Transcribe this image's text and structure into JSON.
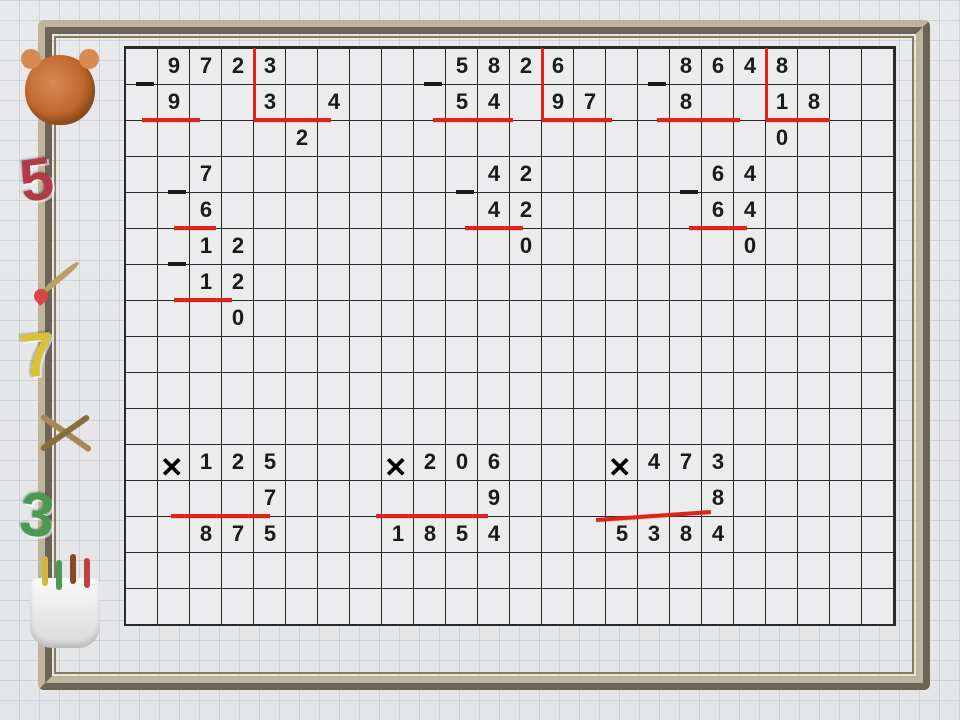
{
  "sidebar": {
    "deco_numbers": {
      "five": "5",
      "seven": "7",
      "three": "3"
    }
  },
  "problems": {
    "top_division": [
      {
        "dividend": "972",
        "divisor": "3",
        "quotient_cells": [
          "3",
          "",
          "4"
        ],
        "steps": [
          "9",
          "",
          "",
          "7",
          "6",
          "1",
          "2",
          "1",
          "2",
          "",
          "0"
        ]
      },
      {
        "dividend": "582",
        "divisor": "6",
        "quotient_cells": [
          "9",
          "7"
        ],
        "steps": [
          "5",
          "4",
          "4",
          "2",
          "4",
          "2",
          "",
          "0"
        ]
      },
      {
        "dividend": "864",
        "divisor": "8",
        "quotient_cells": [
          "1",
          "0",
          "8"
        ],
        "steps": [
          "8",
          "",
          "",
          "6",
          "4",
          "6",
          "4",
          "",
          "0"
        ]
      }
    ],
    "bottom_multiplication": [
      {
        "top": "125",
        "bottom": "7",
        "result": "875"
      },
      {
        "top": "206",
        "bottom": "9",
        "result": "1854"
      },
      {
        "top": "473",
        "bottom": "8",
        "result": "5384"
      }
    ]
  },
  "cells": [
    {
      "r": 0,
      "c": 1,
      "v": "9"
    },
    {
      "r": 0,
      "c": 2,
      "v": "7"
    },
    {
      "r": 0,
      "c": 3,
      "v": "2"
    },
    {
      "r": 0,
      "c": 4,
      "v": "3"
    },
    {
      "r": 1,
      "c": 1,
      "v": "9"
    },
    {
      "r": 1,
      "c": 4,
      "v": "3"
    },
    {
      "r": 1,
      "c": 6,
      "v": "4"
    },
    {
      "r": 2,
      "c": 5,
      "v": "2"
    },
    {
      "r": 3,
      "c": 2,
      "v": "7"
    },
    {
      "r": 4,
      "c": 2,
      "v": "6"
    },
    {
      "r": 5,
      "c": 2,
      "v": "1"
    },
    {
      "r": 5,
      "c": 3,
      "v": "2"
    },
    {
      "r": 6,
      "c": 2,
      "v": "1"
    },
    {
      "r": 6,
      "c": 3,
      "v": "2"
    },
    {
      "r": 7,
      "c": 3,
      "v": "0"
    },
    {
      "r": 0,
      "c": 10,
      "v": "5"
    },
    {
      "r": 0,
      "c": 11,
      "v": "8"
    },
    {
      "r": 0,
      "c": 12,
      "v": "2"
    },
    {
      "r": 0,
      "c": 13,
      "v": "6"
    },
    {
      "r": 1,
      "c": 10,
      "v": "5"
    },
    {
      "r": 1,
      "c": 11,
      "v": "4"
    },
    {
      "r": 1,
      "c": 13,
      "v": "9"
    },
    {
      "r": 1,
      "c": 14,
      "v": "7"
    },
    {
      "r": 3,
      "c": 11,
      "v": "4"
    },
    {
      "r": 3,
      "c": 12,
      "v": "2"
    },
    {
      "r": 4,
      "c": 11,
      "v": "4"
    },
    {
      "r": 4,
      "c": 12,
      "v": "2"
    },
    {
      "r": 5,
      "c": 12,
      "v": "0"
    },
    {
      "r": 0,
      "c": 17,
      "v": "8"
    },
    {
      "r": 0,
      "c": 18,
      "v": "6"
    },
    {
      "r": 0,
      "c": 19,
      "v": "4"
    },
    {
      "r": 0,
      "c": 20,
      "v": "8"
    },
    {
      "r": 1,
      "c": 17,
      "v": "8"
    },
    {
      "r": 1,
      "c": 20,
      "v": "1"
    },
    {
      "r": 1,
      "c": 21,
      "v": "8"
    },
    {
      "r": 2,
      "c": 20,
      "v": "0"
    },
    {
      "r": 3,
      "c": 18,
      "v": "6"
    },
    {
      "r": 3,
      "c": 19,
      "v": "4"
    },
    {
      "r": 4,
      "c": 18,
      "v": "6"
    },
    {
      "r": 4,
      "c": 19,
      "v": "4"
    },
    {
      "r": 5,
      "c": 19,
      "v": "0"
    },
    {
      "r": 11,
      "c": 2,
      "v": "1"
    },
    {
      "r": 11,
      "c": 3,
      "v": "2"
    },
    {
      "r": 11,
      "c": 4,
      "v": "5"
    },
    {
      "r": 12,
      "c": 4,
      "v": "7"
    },
    {
      "r": 13,
      "c": 2,
      "v": "8"
    },
    {
      "r": 13,
      "c": 3,
      "v": "7"
    },
    {
      "r": 13,
      "c": 4,
      "v": "5"
    },
    {
      "r": 11,
      "c": 9,
      "v": "2"
    },
    {
      "r": 11,
      "c": 10,
      "v": "0"
    },
    {
      "r": 11,
      "c": 11,
      "v": "6"
    },
    {
      "r": 12,
      "c": 11,
      "v": "9"
    },
    {
      "r": 13,
      "c": 8,
      "v": "1"
    },
    {
      "r": 13,
      "c": 9,
      "v": "8"
    },
    {
      "r": 13,
      "c": 10,
      "v": "5"
    },
    {
      "r": 13,
      "c": 11,
      "v": "4"
    },
    {
      "r": 11,
      "c": 16,
      "v": "4"
    },
    {
      "r": 11,
      "c": 17,
      "v": "7"
    },
    {
      "r": 11,
      "c": 18,
      "v": "3"
    },
    {
      "r": 12,
      "c": 18,
      "v": "8"
    },
    {
      "r": 13,
      "c": 15,
      "v": "5"
    },
    {
      "r": 13,
      "c": 16,
      "v": "3"
    },
    {
      "r": 13,
      "c": 17,
      "v": "8"
    },
    {
      "r": 13,
      "c": 18,
      "v": "4"
    }
  ],
  "red_h": [
    {
      "r": 2,
      "c": 0.5,
      "w": 1.8
    },
    {
      "r": 5,
      "c": 1.5,
      "w": 1.3
    },
    {
      "r": 7,
      "c": 1.5,
      "w": 1.8
    },
    {
      "r": 2,
      "c": 4,
      "w": 2.4
    },
    {
      "r": 2,
      "c": 9.6,
      "w": 2.5
    },
    {
      "r": 5,
      "c": 10.6,
      "w": 1.8
    },
    {
      "r": 2,
      "c": 13,
      "w": 2.2
    },
    {
      "r": 2,
      "c": 16.6,
      "w": 2.6
    },
    {
      "r": 5,
      "c": 17.6,
      "w": 1.8
    },
    {
      "r": 2,
      "c": 20,
      "w": 2
    },
    {
      "r": 13,
      "c": 1.4,
      "w": 3.1
    },
    {
      "r": 13,
      "c": 7.8,
      "w": 3.5
    },
    {
      "r": 13,
      "c": 14.7,
      "w": 3.6,
      "rot": -4
    }
  ],
  "red_v": [
    {
      "r": 0,
      "c": 4,
      "h": 2
    },
    {
      "r": 0,
      "c": 13,
      "h": 2
    },
    {
      "r": 0,
      "c": 20,
      "h": 2
    }
  ],
  "minus_signs": [
    {
      "r": 0.5,
      "c": 0.3
    },
    {
      "r": 3.5,
      "c": 1.3
    },
    {
      "r": 5.5,
      "c": 1.3
    },
    {
      "r": 0.5,
      "c": 9.3
    },
    {
      "r": 3.5,
      "c": 10.3
    },
    {
      "r": 0.5,
      "c": 16.3
    },
    {
      "r": 3.5,
      "c": 17.3
    }
  ],
  "x_signs": [
    {
      "r": 11.2,
      "c": 1.0,
      "v": "✕"
    },
    {
      "r": 11.2,
      "c": 8.0,
      "v": "✕"
    },
    {
      "r": 11.2,
      "c": 15.0,
      "v": "✕"
    }
  ]
}
